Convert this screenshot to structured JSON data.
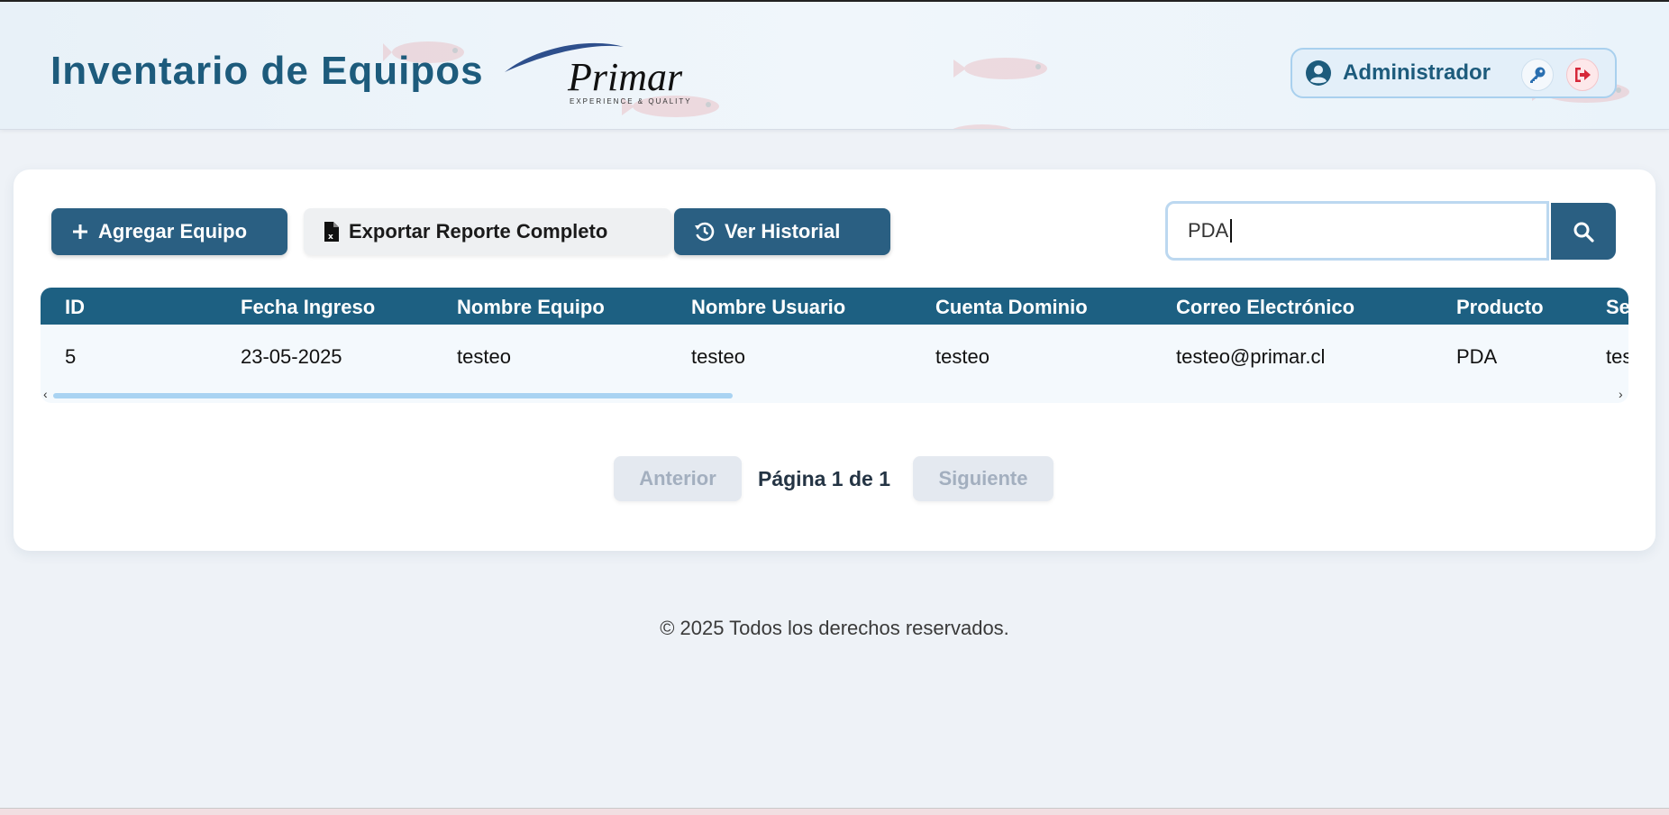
{
  "header": {
    "title": "Inventario de Equipos",
    "logo_name": "Primar",
    "logo_tagline": "EXPERIENCE & QUALITY",
    "user_label": "Administrador"
  },
  "toolbar": {
    "add_label": "Agregar Equipo",
    "export_label": "Exportar Reporte Completo",
    "history_label": "Ver Historial"
  },
  "search": {
    "value": "PDA",
    "placeholder": ""
  },
  "table": {
    "columns": [
      "ID",
      "Fecha Ingreso",
      "Nombre Equipo",
      "Nombre Usuario",
      "Cuenta Dominio",
      "Correo Electrónico",
      "Producto",
      "Ser"
    ],
    "rows": [
      [
        "5",
        "23-05-2025",
        "testeo",
        "testeo",
        "testeo",
        "testeo@primar.cl",
        "PDA",
        "teste"
      ]
    ]
  },
  "pagination": {
    "prev_label": "Anterior",
    "page_info": "Página 1 de 1",
    "next_label": "Siguiente"
  },
  "footer": {
    "copyright": "© 2025 Todos los derechos reservados."
  },
  "colors": {
    "primary": "#2a5f82",
    "header_text": "#1d5b7c",
    "table_header": "#1d6082",
    "logout": "#d62839"
  },
  "icons": [
    "plus-icon",
    "excel-file-icon",
    "history-icon",
    "search-icon",
    "user-circle-icon",
    "key-icon",
    "logout-icon"
  ]
}
